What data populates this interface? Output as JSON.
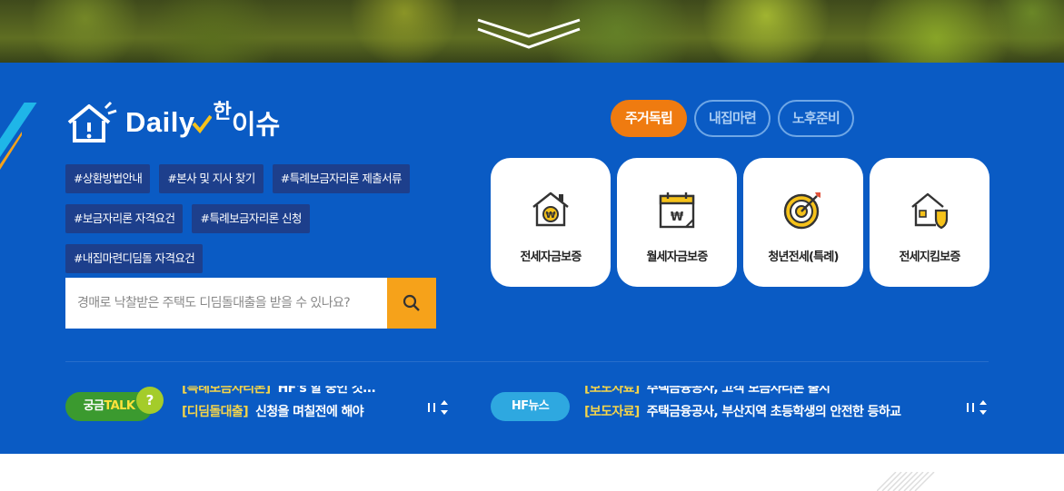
{
  "logo": {
    "brand": "Daily",
    "han": "한",
    "issue": "이슈"
  },
  "tags": [
    "#상환방법안내",
    "#본사 및 지사 찾기",
    "#특례보금자리론 제출서류",
    "#보금자리론 자격요건",
    "#특례보금자리론 신청",
    "#내집마련디딤돌 자격요건"
  ],
  "search": {
    "placeholder": "경매로 낙찰받은 주택도 디딤돌대출을 받을 수 있나요?"
  },
  "tabs": [
    {
      "label": "주거독립",
      "active": true
    },
    {
      "label": "내집마련",
      "active": false
    },
    {
      "label": "노후준비",
      "active": false
    }
  ],
  "cards": [
    {
      "label": "전세자금보증",
      "icon": "house-coin-icon"
    },
    {
      "label": "월세자금보증",
      "icon": "calendar-won-icon"
    },
    {
      "label": "청년전세(특례)",
      "icon": "target-icon"
    },
    {
      "label": "전세지킴보증",
      "icon": "house-shield-icon"
    }
  ],
  "talk": {
    "badge_prefix": "궁금",
    "badge_suffix": "TALK",
    "badge_q": "?",
    "items": [
      {
        "cat": "[특례보금자리론]",
        "text": "HF's 할 중인 것..."
      },
      {
        "cat": "[디딤돌대출]",
        "text": "신청을 며칠전에 해야"
      }
    ]
  },
  "news": {
    "badge": "HF뉴스",
    "items": [
      {
        "cat": "[보도자료]",
        "text": "주택금융공사, 고객 보금자리론 출시"
      },
      {
        "cat": "[보도자료]",
        "text": "주택금융공사, 부산지역 초등학생의 안전한 등하교"
      }
    ]
  },
  "colors": {
    "main_blue": "#0a5bc4",
    "active_tab": "#ef7b10",
    "search_button": "#f6a21a",
    "talk_badge": "#3b9a2f",
    "news_badge": "#2ea8e0",
    "tag_bg": "#1d3f8c"
  }
}
